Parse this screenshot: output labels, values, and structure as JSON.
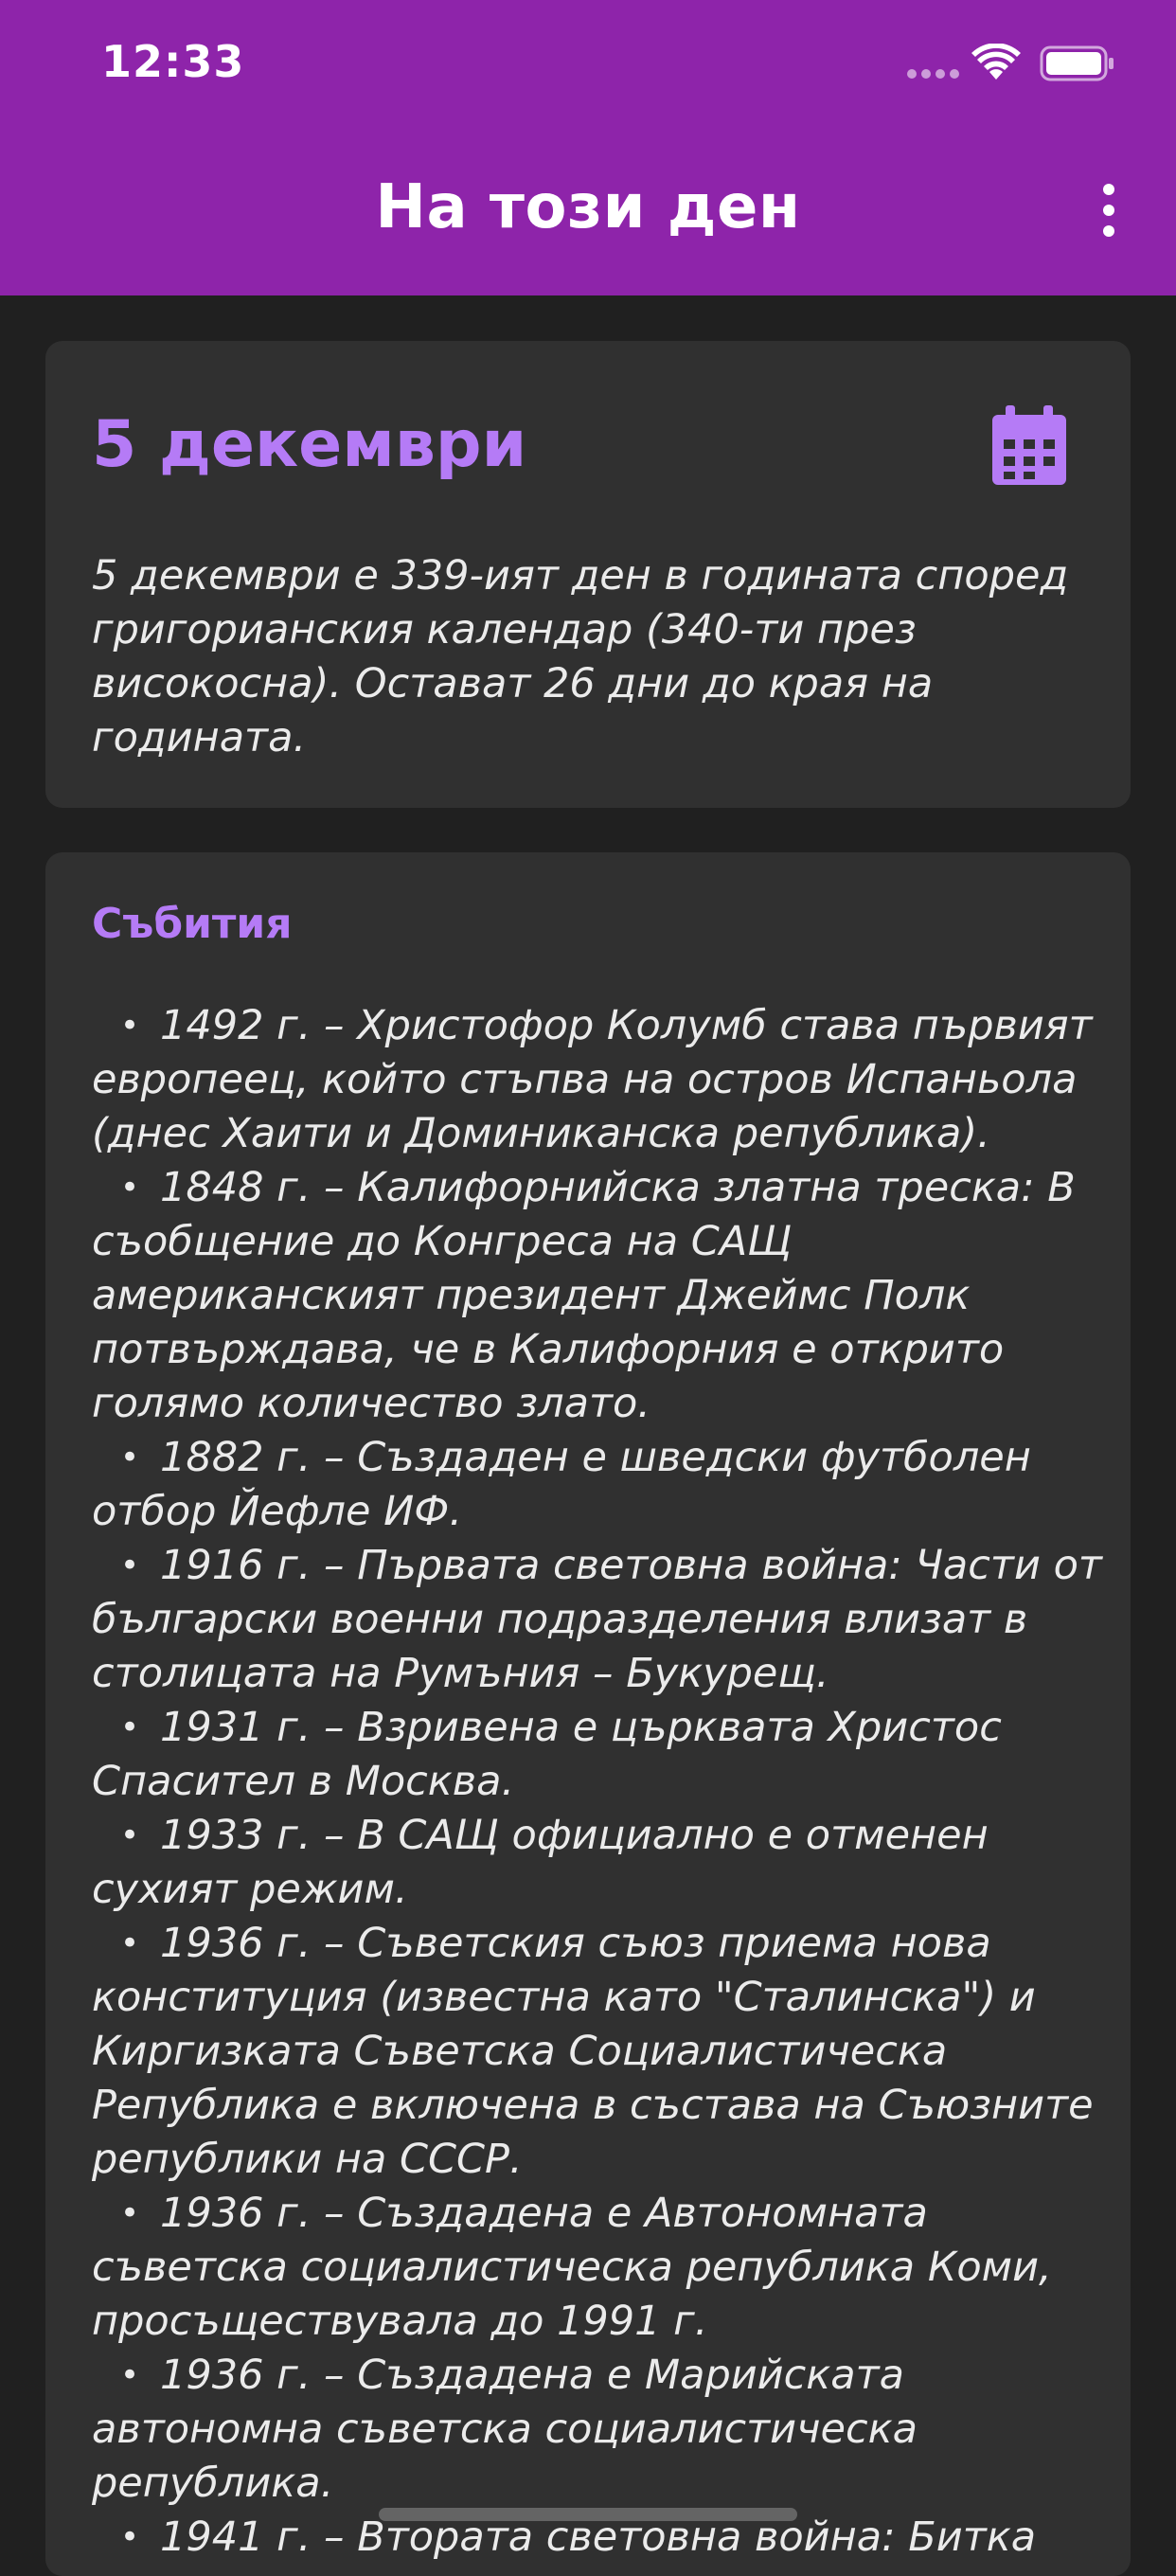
{
  "status_bar": {
    "time": "12:33"
  },
  "app_bar": {
    "title": "На този ден",
    "more_icon": "more-vertical-icon"
  },
  "date_card": {
    "title": "5 декември",
    "calendar_icon": "calendar-icon",
    "description": "5 декември е 339-ият ден в годината според григорианския календар (340-ти през високосна). Остават 26 дни до края на годината."
  },
  "events_card": {
    "title": "Събития",
    "items": [
      "1492 г. – Христофор Колумб става първият европеец, който стъпва на остров Испаньола (днес Хаити и Доминиканска република).",
      "1848 г. – Калифорнийска златна треска: В съобщение до Конгреса на САЩ американският президент Джеймс Полк потвърждава, че в Калифорния е открито голямо количество злато.",
      "1882 г. – Създаден е шведски футболен отбор Йефле ИФ.",
      "1916 г. – Първата световна война: Части от български военни подразделения влизат в столицата на Румъния – Букурещ.",
      "1931 г. – Взривена е църквата Христос Спасител в Москва.",
      "1933 г. – В САЩ официално е отменен сухият режим.",
      "1936 г. – Съветския съюз приема нова конституция (известна като \"Сталинска\") и Киргизката Съветска Социалистическа Република е включена в състава на Съюзните републики на СССР.",
      "1936 г. – Създадена е Автономната съветска социалистическа република Коми, просъществувала до 1991 г.",
      "1936 г. – Създадена е Марийската автономна съветска социалистическа република.",
      "1941 г. – Втората световна война: Битка"
    ]
  },
  "colors": {
    "app_bar": "#8e24aa",
    "accent": "#b57bf6",
    "background": "#202020",
    "card": "#303030",
    "text": "#ebebeb"
  }
}
